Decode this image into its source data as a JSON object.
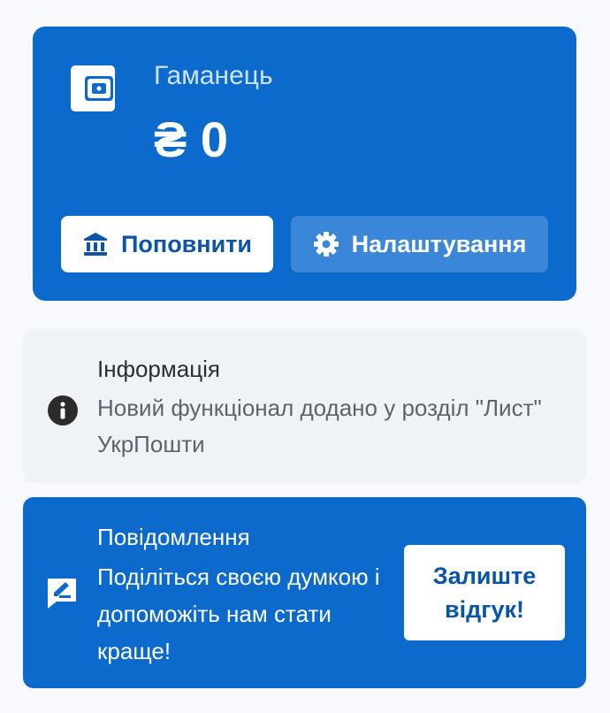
{
  "wallet": {
    "title": "Гаманець",
    "amount": "₴ 0",
    "icon": "wallet-icon",
    "topup_button": {
      "label": "Поповнити",
      "icon": "bank-icon"
    },
    "settings_button": {
      "label": "Налаштування",
      "icon": "gear-icon"
    }
  },
  "info": {
    "icon": "info-icon",
    "title": "Інформація",
    "text": "Новий функціонал додано у розділ \"Лист\" УкрПошти"
  },
  "message": {
    "icon": "edit-icon",
    "title": "Повідомлення",
    "text": "Поділіться своєю думкою і допоможіть нам стати краще!",
    "feedback_button": "Залиште відгук!"
  },
  "colors": {
    "primary": "#0b6acb",
    "button_secondary": "#3a86d9",
    "info_bg": "#eff2f6",
    "background": "#f8f9fc"
  }
}
